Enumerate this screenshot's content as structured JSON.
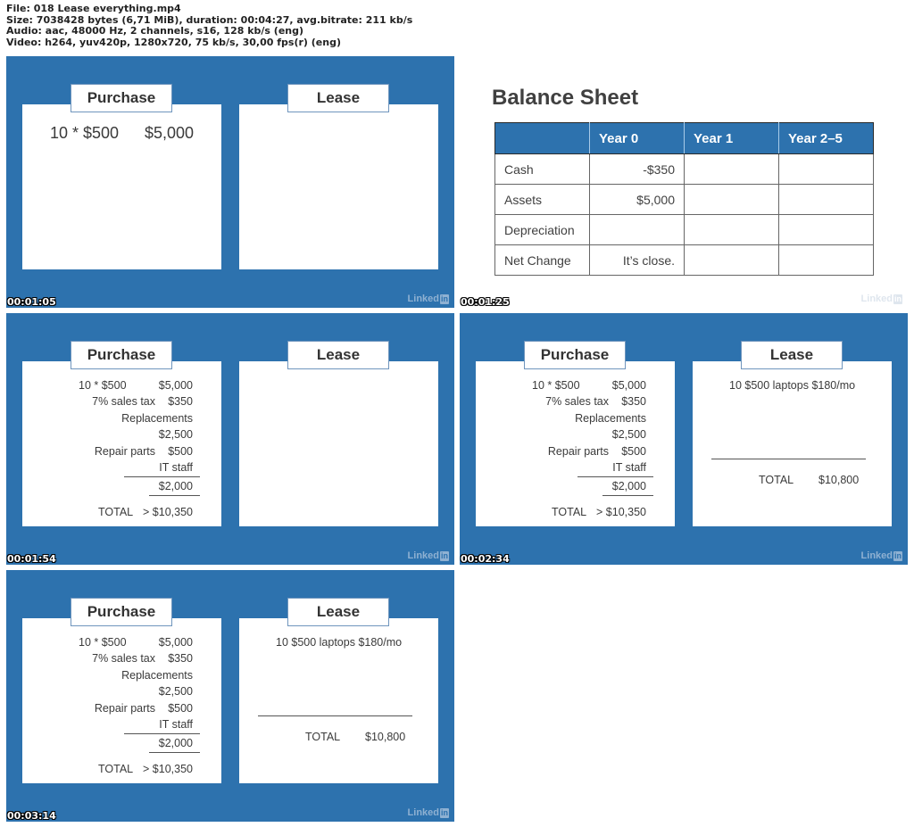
{
  "file_info": {
    "line1": "File: 018 Lease everything.mp4",
    "line2": "Size: 7038428 bytes (6,71 MiB), duration: 00:04:27, avg.bitrate: 211 kb/s",
    "line3": "Audio: aac, 48000 Hz, 2 channels, s16, 128 kb/s (eng)",
    "line4": "Video: h264, yuv420p, 1280x720, 75 kb/s, 30,00 fps(r) (eng)"
  },
  "brand": {
    "logo_text": "Linked",
    "logo_badge": "in",
    "slide_blue": "#2d72ae"
  },
  "frames": [
    {
      "timestamp": "00:01:05",
      "purchase": {
        "title": "Purchase",
        "lines": [
          {
            "label": "10 * $500",
            "value": "$5,000"
          }
        ]
      },
      "lease": {
        "title": "Lease"
      }
    },
    {
      "timestamp": "00:01:25",
      "balance_sheet": {
        "title": "Balance Sheet",
        "columns": [
          "",
          "Year 0",
          "Year 1",
          "Year 2–5"
        ],
        "rows": [
          {
            "label": "Cash",
            "year0": "-$350",
            "year1": "",
            "year2_5": ""
          },
          {
            "label": "Assets",
            "year0": "$5,000",
            "year1": "",
            "year2_5": ""
          },
          {
            "label": "Depreciation",
            "year0": "",
            "year1": "",
            "year2_5": ""
          },
          {
            "label": "Net Change",
            "year0": "It’s close.",
            "year1": "",
            "year2_5": ""
          }
        ]
      }
    },
    {
      "timestamp": "00:01:54",
      "purchase": {
        "title": "Purchase",
        "lines": {
          "units": "10 * $500",
          "units_value": "$5,000",
          "tax": "7% sales tax",
          "tax_value": "$350",
          "replacements": "Replacements",
          "replacements_value": "$2,500",
          "repair": "Repair parts",
          "repair_value": "$500",
          "it_staff": "IT staff",
          "it_staff_value": "$2,000",
          "total_label": "TOTAL",
          "total_value": "> $10,350"
        }
      },
      "lease": {
        "title": "Lease"
      }
    },
    {
      "timestamp": "00:02:34",
      "purchase": {
        "title": "Purchase",
        "lines": {
          "units": "10 * $500",
          "units_value": "$5,000",
          "tax": "7% sales tax",
          "tax_value": "$350",
          "replacements": "Replacements",
          "replacements_value": "$2,500",
          "repair": "Repair parts",
          "repair_value": "$500",
          "it_staff": "IT staff",
          "it_staff_value": "$2,000",
          "total_label": "TOTAL",
          "total_value": "> $10,350"
        }
      },
      "lease": {
        "title": "Lease",
        "line": "10 $500 laptops $180/mo",
        "total_label": "TOTAL",
        "total_value": "$10,800"
      }
    },
    {
      "timestamp": "00:03:14",
      "purchase": {
        "title": "Purchase",
        "lines": {
          "units": "10 * $500",
          "units_value": "$5,000",
          "tax": "7% sales tax",
          "tax_value": "$350",
          "replacements": "Replacements",
          "replacements_value": "$2,500",
          "repair": "Repair parts",
          "repair_value": "$500",
          "it_staff": "IT staff",
          "it_staff_value": "$2,000",
          "total_label": "TOTAL",
          "total_value": "> $10,350"
        }
      },
      "lease": {
        "title": "Lease",
        "line": "10 $500 laptops $180/mo",
        "total_label": "TOTAL",
        "total_value": "$10,800"
      }
    }
  ]
}
